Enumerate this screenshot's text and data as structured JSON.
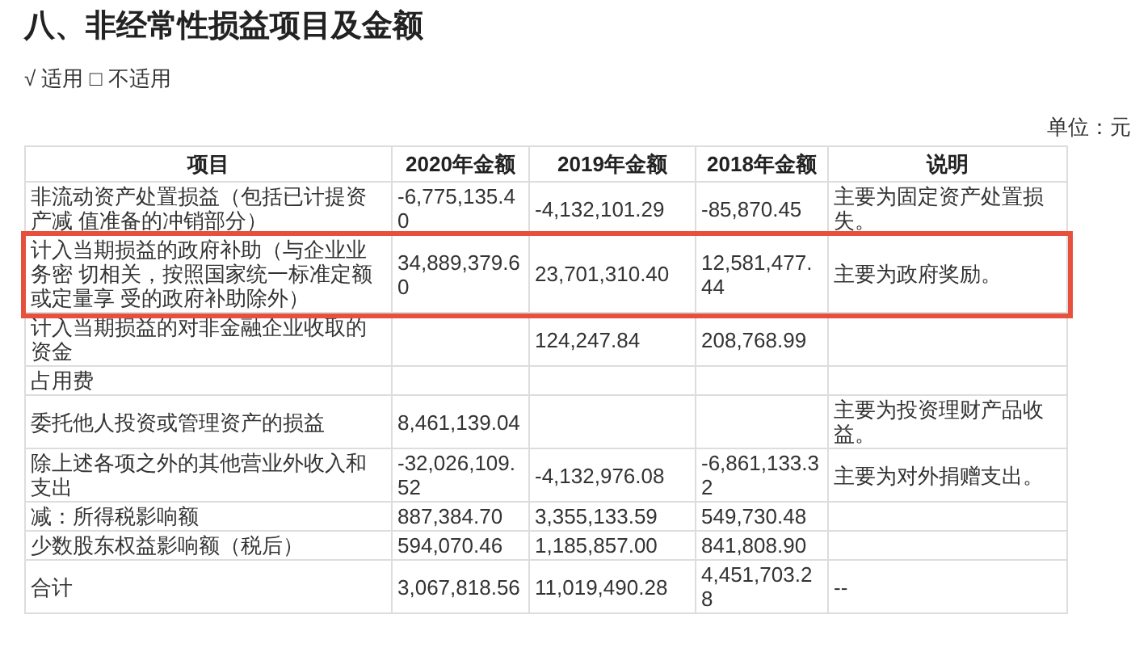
{
  "heading": "八、非经常性损益项目及金额",
  "applicability": "√ 适用 □ 不适用",
  "unit": "单位：元",
  "table": {
    "columns": [
      "项目",
      "2020年金额",
      "2019年金额",
      "2018年金额",
      "说明"
    ],
    "rows": [
      {
        "cells": [
          "非流动资产处置损益（包括已计提资产减 值准备的冲销部分）",
          "-6,775,135.40",
          "-4,132,101.29",
          "-85,870.45",
          "主要为固定资产处置损失。"
        ],
        "highlighted": false
      },
      {
        "cells": [
          "计入当期损益的政府补助（与企业业务密 切相关，按照国家统一标准定额或定量享 受的政府补助除外）",
          "34,889,379.60",
          "23,701,310.40",
          "12,581,477.44",
          "主要为政府奖励。"
        ],
        "highlighted": true
      },
      {
        "cells": [
          "计入当期损益的对非金融企业收取的资金",
          "",
          "124,247.84",
          "208,768.99",
          ""
        ],
        "highlighted": false
      },
      {
        "cells": [
          "占用费",
          "",
          "",
          "",
          ""
        ],
        "highlighted": false
      },
      {
        "cells": [
          "委托他人投资或管理资产的损益",
          "8,461,139.04",
          "",
          "",
          "主要为投资理财产品收益。"
        ],
        "highlighted": false
      },
      {
        "cells": [
          "除上述各项之外的其他营业外收入和支出",
          "-32,026,109.52",
          "-4,132,976.08",
          "-6,861,133.32",
          "主要为对外捐赠支出。"
        ],
        "highlighted": false
      },
      {
        "cells": [
          "减：所得税影响额",
          "887,384.70",
          "3,355,133.59",
          "549,730.48",
          ""
        ],
        "highlighted": false
      },
      {
        "cells": [
          "少数股东权益影响额（税后）",
          "594,070.46",
          "1,185,857.00",
          "841,808.90",
          ""
        ],
        "highlighted": false
      },
      {
        "cells": [
          "合计",
          "3,067,818.56",
          "11,019,490.28",
          "4,451,703.28",
          "--"
        ],
        "highlighted": false
      }
    ]
  }
}
